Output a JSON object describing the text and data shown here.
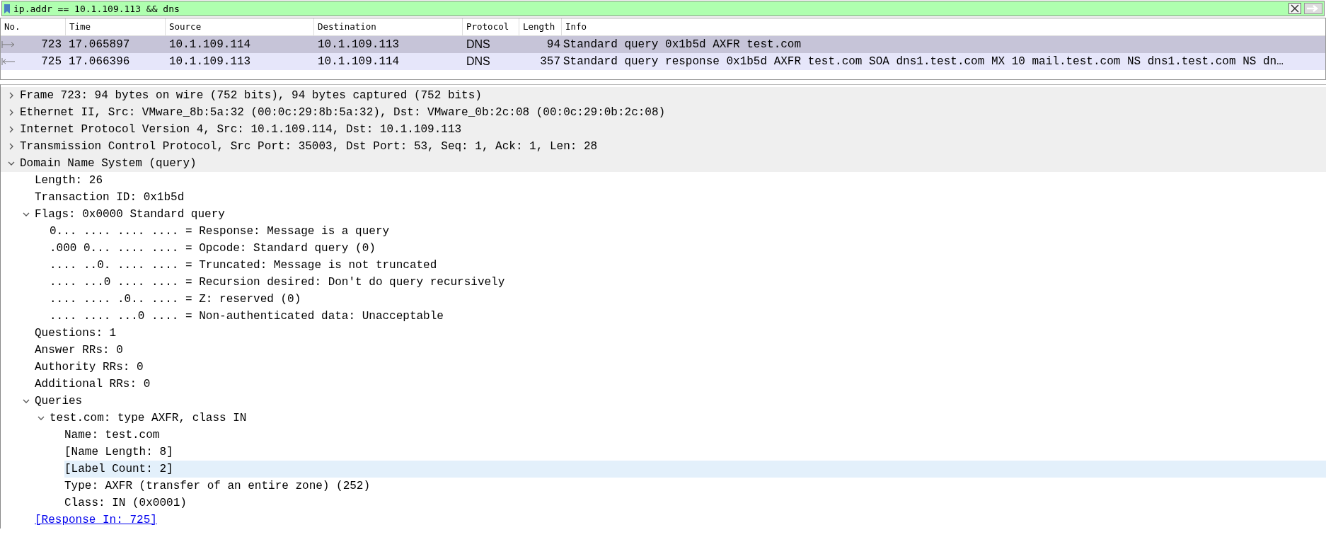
{
  "filter": {
    "value": "ip.addr == 10.1.109.113 && dns"
  },
  "packet_list": {
    "columns": [
      "No.",
      "Time",
      "Source",
      "Destination",
      "Protocol",
      "Length",
      "Info"
    ],
    "rows": [
      {
        "kind": "request",
        "selected": true,
        "cells": [
          "723",
          "17.065897",
          "10.1.109.114",
          "10.1.109.113",
          "DNS",
          "94",
          "Standard query 0x1b5d AXFR test.com"
        ]
      },
      {
        "kind": "response",
        "selected": false,
        "color": "#e6e6fa",
        "cells": [
          "725",
          "17.066396",
          "10.1.109.113",
          "10.1.109.114",
          "DNS",
          "357",
          "Standard query response 0x1b5d AXFR test.com SOA dns1.test.com MX 10 mail.test.com NS dns1.test.com NS dn…"
        ]
      }
    ]
  },
  "details": [
    {
      "kind": "field",
      "text": "Frame 723: 94 bytes on wire (752 bits), 94 bytes captured (752 bits)",
      "expanded": false,
      "selected": false
    },
    {
      "kind": "field",
      "text": "Ethernet II, Src: VMware_8b:5a:32 (00:0c:29:8b:5a:32), Dst: VMware_0b:2c:08 (00:0c:29:0b:2c:08)",
      "expanded": false,
      "selected": false
    },
    {
      "kind": "field",
      "text": "Internet Protocol Version 4, Src: 10.1.109.114, Dst: 10.1.109.113",
      "expanded": false,
      "selected": false
    },
    {
      "kind": "field",
      "text": "Transmission Control Protocol, Src Port: 35003, Dst Port: 53, Seq: 1, Ack: 1, Len: 28",
      "expanded": false,
      "selected": false
    },
    {
      "kind": "field",
      "text": "Domain Name System (query)",
      "expanded": true,
      "selected": false,
      "children": [
        {
          "kind": "field",
          "text": "Length: 26",
          "selected": false
        },
        {
          "kind": "field",
          "text": "Transaction ID: 0x1b5d",
          "selected": false
        },
        {
          "kind": "field",
          "text": "Flags: 0x0000 Standard query",
          "expanded": true,
          "selected": false,
          "children": [
            {
              "kind": "field",
              "text": "0... .... .... .... = Response: Message is a query",
              "selected": false
            },
            {
              "kind": "field",
              "text": ".000 0... .... .... = Opcode: Standard query (0)",
              "selected": false
            },
            {
              "kind": "field",
              "text": ".... ..0. .... .... = Truncated: Message is not truncated",
              "selected": false
            },
            {
              "kind": "field",
              "text": ".... ...0 .... .... = Recursion desired: Don't do query recursively",
              "selected": false
            },
            {
              "kind": "field",
              "text": ".... .... .0.. .... = Z: reserved (0)",
              "selected": false
            },
            {
              "kind": "field",
              "text": ".... .... ...0 .... = Non-authenticated data: Unacceptable",
              "selected": false
            }
          ]
        },
        {
          "kind": "field",
          "text": "Questions: 1",
          "selected": false
        },
        {
          "kind": "field",
          "text": "Answer RRs: 0",
          "selected": false
        },
        {
          "kind": "field",
          "text": "Authority RRs: 0",
          "selected": false
        },
        {
          "kind": "field",
          "text": "Additional RRs: 0",
          "selected": false
        },
        {
          "kind": "field",
          "text": "Queries",
          "expanded": true,
          "selected": false,
          "children": [
            {
              "kind": "field",
              "text": "test.com: type AXFR, class IN",
              "expanded": true,
              "selected": false,
              "children": [
                {
                  "kind": "field",
                  "text": "Name: test.com",
                  "selected": false
                },
                {
                  "kind": "field",
                  "text": "[Name Length: 8]",
                  "selected": false
                },
                {
                  "kind": "field",
                  "text": "[Label Count: 2]",
                  "selected": true
                },
                {
                  "kind": "field",
                  "text": "Type: AXFR (transfer of an entire zone) (252)",
                  "selected": false
                },
                {
                  "kind": "field",
                  "text": "Class: IN (0x0001)",
                  "selected": false
                }
              ]
            }
          ]
        },
        {
          "kind": "link",
          "text": "[Response In: 725]",
          "selected": false
        }
      ]
    }
  ]
}
